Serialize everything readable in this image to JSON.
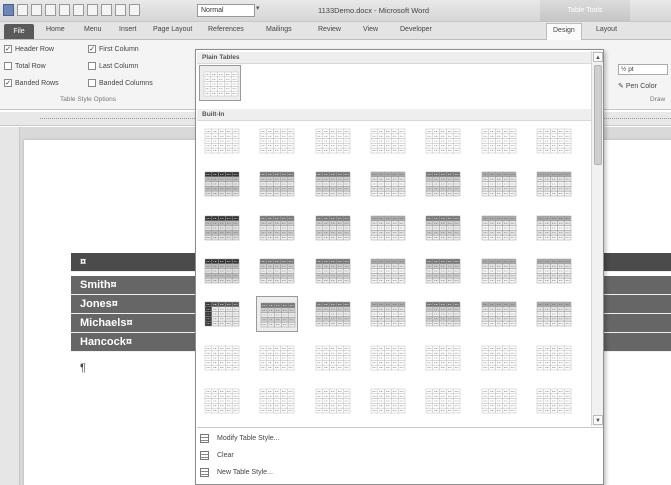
{
  "titlebar": {
    "style_box": "Normal",
    "window_title": "1133Demo.docx - Microsoft Word",
    "context_tab": "Table Tools"
  },
  "tabs": [
    "File",
    "Home",
    "Menu",
    "Insert",
    "Page Layout",
    "References",
    "Mailings",
    "Review",
    "View",
    "Developer",
    "Design",
    "Layout"
  ],
  "active_tab": "Design",
  "style_options": {
    "items": [
      {
        "label": "Header Row",
        "checked": true
      },
      {
        "label": "First Column",
        "checked": true
      },
      {
        "label": "Total Row",
        "checked": false
      },
      {
        "label": "Last Column",
        "checked": false
      },
      {
        "label": "Banded Rows",
        "checked": true
      },
      {
        "label": "Banded Columns",
        "checked": false
      }
    ],
    "group_label": "Table Style Options"
  },
  "right_ribbon": {
    "pen_weight": "½ pt",
    "pen_color": "Pen Color",
    "draw_group": "Draw"
  },
  "gallery": {
    "plain_header": "Plain Tables",
    "builtin_header": "Built-In",
    "menu": [
      {
        "label": "Modify Table Style..."
      },
      {
        "label": "Clear"
      },
      {
        "label": "New Table Style..."
      }
    ]
  },
  "document": {
    "header_cell": "¤",
    "rows": [
      "Smith¤",
      "Jones¤",
      "Michaels¤",
      "Hancock¤"
    ],
    "pilcrow": "¶"
  }
}
